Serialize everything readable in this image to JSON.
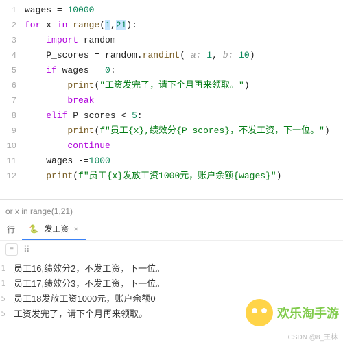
{
  "code": {
    "lines": [
      {
        "n": "1",
        "in": 0,
        "tokens": [
          [
            "id",
            "wages"
          ],
          [
            "id",
            " = "
          ],
          [
            "num",
            "10000"
          ]
        ]
      },
      {
        "n": "2",
        "in": 0,
        "tokens": [
          [
            "kw2",
            "for"
          ],
          [
            "id",
            " x "
          ],
          [
            "kw2",
            "in"
          ],
          [
            "id",
            " "
          ],
          [
            "fn",
            "range"
          ],
          [
            "id",
            "("
          ],
          [
            "hl",
            "1"
          ],
          [
            "id",
            ","
          ],
          [
            "hl",
            "21"
          ],
          [
            "id",
            ")"
          ],
          [
            "id",
            ":"
          ]
        ]
      },
      {
        "n": "3",
        "in": 1,
        "tokens": [
          [
            "kw2",
            "import"
          ],
          [
            "id",
            " random"
          ]
        ]
      },
      {
        "n": "4",
        "in": 1,
        "tokens": [
          [
            "id",
            "P_scores = random."
          ],
          [
            "fn",
            "randint"
          ],
          [
            "id",
            "("
          ],
          [
            "hint",
            " a: "
          ],
          [
            "num",
            "1"
          ],
          [
            "id",
            ", "
          ],
          [
            "hint",
            "b: "
          ],
          [
            "num",
            "10"
          ],
          [
            "id",
            ")"
          ]
        ]
      },
      {
        "n": "5",
        "in": 1,
        "tokens": [
          [
            "kw2",
            "if"
          ],
          [
            "id",
            " wages =="
          ],
          [
            "num",
            "0"
          ],
          [
            "id",
            ":"
          ]
        ]
      },
      {
        "n": "6",
        "in": 2,
        "tokens": [
          [
            "fn",
            "print"
          ],
          [
            "id",
            "("
          ],
          [
            "str",
            "\"工资发完了，请下个月再来领取。\""
          ],
          [
            "id",
            ")"
          ]
        ]
      },
      {
        "n": "7",
        "in": 2,
        "tokens": [
          [
            "kw2",
            "break"
          ]
        ]
      },
      {
        "n": "8",
        "in": 1,
        "tokens": [
          [
            "kw2",
            "elif"
          ],
          [
            "id",
            " P_scores < "
          ],
          [
            "num",
            "5"
          ],
          [
            "id",
            ":"
          ]
        ]
      },
      {
        "n": "9",
        "in": 2,
        "tokens": [
          [
            "fn",
            "print"
          ],
          [
            "id",
            "("
          ],
          [
            "str",
            "f\"员工{x},绩效分{P_scores}，不发工资，下一位。\""
          ],
          [
            "id",
            ")"
          ]
        ]
      },
      {
        "n": "10",
        "in": 2,
        "tokens": [
          [
            "kw2",
            "continue"
          ]
        ]
      },
      {
        "n": "11",
        "in": 1,
        "tokens": [
          [
            "id",
            "wages -="
          ],
          [
            "num",
            "1000"
          ]
        ]
      },
      {
        "n": "12",
        "in": 1,
        "tokens": [
          [
            "fn",
            "print"
          ],
          [
            "id",
            "("
          ],
          [
            "str",
            "f\"员工{x}发放工资1000元，账户余额{wages}\""
          ],
          [
            "id",
            ")"
          ]
        ]
      }
    ]
  },
  "breadcrumb": "or x in range(1,21)",
  "tabs": {
    "run": "行",
    "active_icon": "🐍",
    "active_label": "发工资",
    "close": "×"
  },
  "toolbar": {
    "btn": "≡",
    "dots": "⠿"
  },
  "output": {
    "lines": [
      {
        "n": "1",
        "text": "员工16,绩效分2，不发工资，下一位。"
      },
      {
        "n": "1",
        "text": "员工17,绩效分3，不发工资，下一位。"
      },
      {
        "n": "5",
        "text": "员工18发放工资1000元，账户余额0"
      },
      {
        "n": "5",
        "text": "工资发完了，请下个月再来领取。"
      }
    ]
  },
  "watermark": {
    "text": "欢乐淘手游"
  },
  "credit": "CSDN @8_王林"
}
